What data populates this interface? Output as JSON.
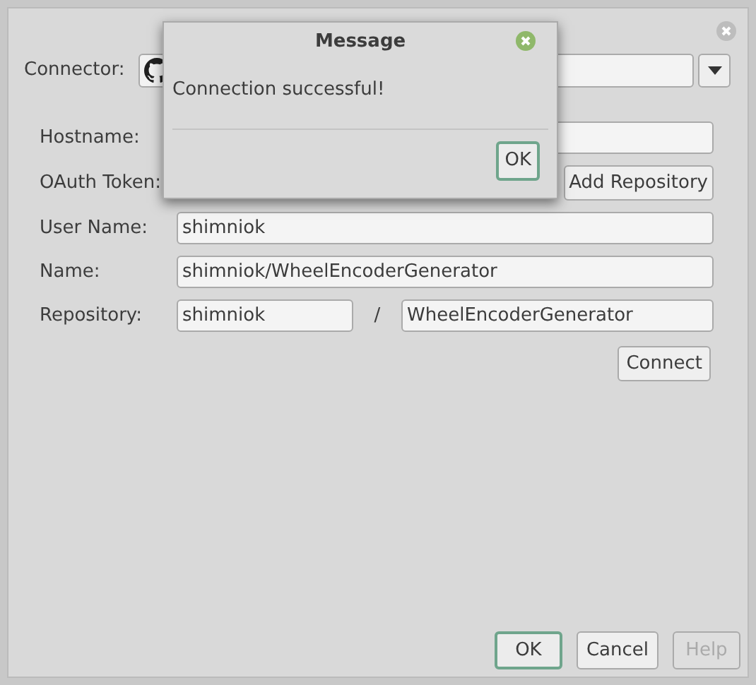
{
  "dialog": {
    "connector_label": "Connector:",
    "rows": [
      {
        "label": "Hostname:",
        "value": ""
      },
      {
        "label": "OAuth Token:",
        "value": "",
        "button": "Add Repository"
      },
      {
        "label": "User Name:",
        "value": "shimniok"
      },
      {
        "label": "Name:",
        "value": "shimniok/WheelEncoderGenerator"
      }
    ],
    "repository": {
      "label": "Repository:",
      "owner": "shimniok",
      "separator": "/",
      "name": "WheelEncoderGenerator"
    },
    "connect_button": "Connect",
    "buttons": [
      {
        "label": "OK",
        "focused": true,
        "disabled": false
      },
      {
        "label": "Cancel",
        "focused": false,
        "disabled": false
      },
      {
        "label": "Help",
        "focused": false,
        "disabled": true
      }
    ]
  },
  "message": {
    "title": "Message",
    "text": "Connection successful!",
    "button": "OK"
  }
}
